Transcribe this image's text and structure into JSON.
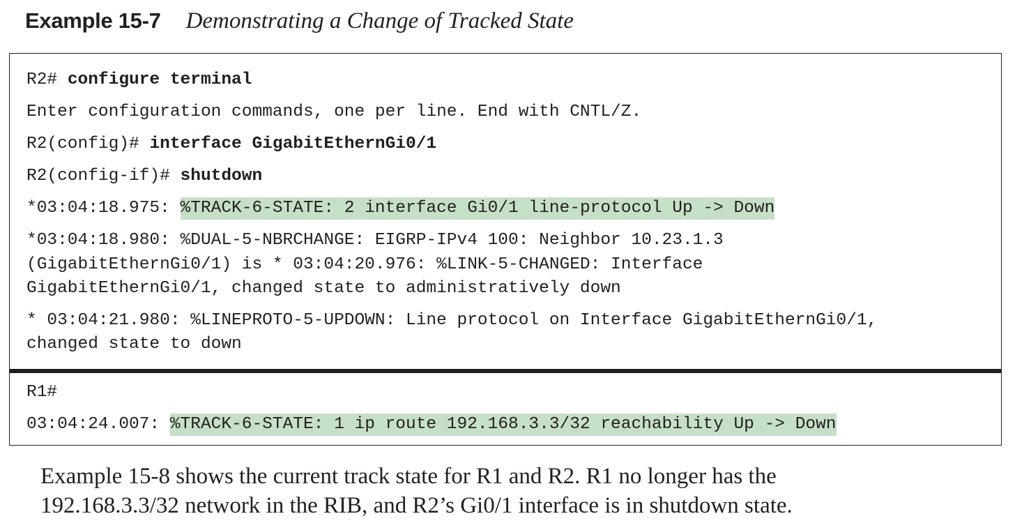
{
  "heading": {
    "label": "Example 15-7",
    "caption": "Demonstrating a Change of Tracked State"
  },
  "r2_output": {
    "line1_prompt": "R2# ",
    "line1_cmd": "configure terminal",
    "line2": "Enter configuration commands, one per line. End with CNTL/Z.",
    "line3_prompt": "R2(config)# ",
    "line3_cmd": "interface GigabitEthernGi0/1",
    "line4_prompt": "R2(config-if)# ",
    "line4_cmd": "shutdown",
    "line5_time": "*03:04:18.975: ",
    "line5_msg": "%TRACK-6-STATE: 2 interface Gi0/1 line-protocol Up -> Down",
    "line6a": "*03:04:18.980: %DUAL-5-NBRCHANGE: EIGRP-IPv4 100: Neighbor 10.23.1.3",
    "line6b": "(GigabitEthernGi0/1) is * 03:04:20.976: %LINK-5-CHANGED: Interface",
    "line6c": "GigabitEthernGi0/1, changed state to administratively down",
    "line7a": "* 03:04:21.980: %LINEPROTO-5-UPDOWN: Line protocol on Interface GigabitEthernGi0/1,",
    "line7b": "changed state to down"
  },
  "r1_output": {
    "line1_prompt": "R1#",
    "line2_time": "03:04:24.007: ",
    "line2_msg": "%TRACK-6-STATE: 1 ip route 192.168.3.3/32 reachability Up -> Down"
  },
  "body": {
    "line1": "Example 15-8 shows the current track state for R1 and R2. R1 no longer has the",
    "line2": "192.168.3.3/32 network in the RIB, and R2’s Gi0/1 interface is in shutdown state."
  },
  "colors": {
    "highlight": "#c6e0c7",
    "text": "#231f20",
    "border": "#231f20"
  }
}
